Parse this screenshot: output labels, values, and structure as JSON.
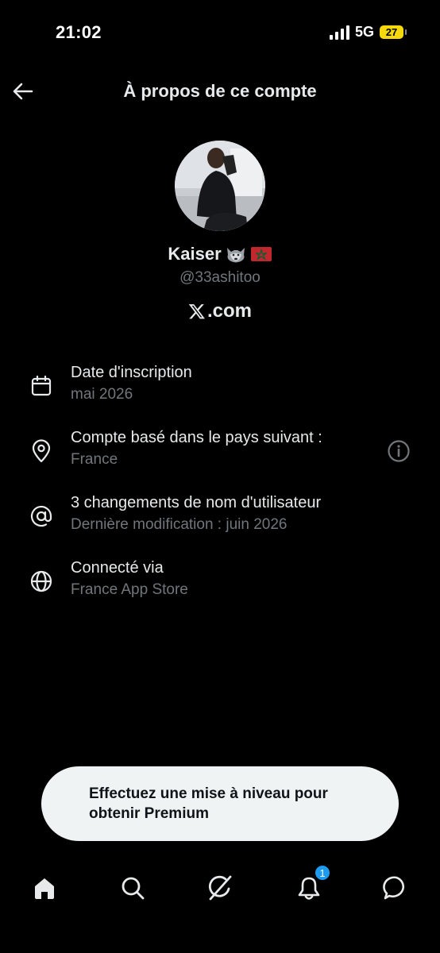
{
  "status_bar": {
    "time": "21:02",
    "network": "5G",
    "battery": "27"
  },
  "header": {
    "title": "À propos de ce compte"
  },
  "profile": {
    "display_name": "Kaiser",
    "username": "@33ashitoo",
    "brand": "X.com",
    "brand_suffix": ".com"
  },
  "info_items": [
    {
      "icon": "calendar-icon",
      "title": "Date d'inscription",
      "subtitle": "mai 2026"
    },
    {
      "icon": "location-pin-icon",
      "title": "Compte basé dans le pays suivant :",
      "subtitle": "France"
    },
    {
      "icon": "at-sign-icon",
      "title": "3 changements de nom d'utilisateur",
      "subtitle": "Dernière modification : juin 2026"
    },
    {
      "icon": "globe-icon",
      "title": "Connecté via",
      "subtitle": "France App Store"
    }
  ],
  "premium_banner": {
    "text": "Effectuez une mise à niveau pour obtenir Premium"
  },
  "bottom_nav": {
    "items": [
      "home-icon",
      "search-icon",
      "grok-icon",
      "notifications-icon",
      "messages-icon"
    ],
    "notification_count": "1"
  },
  "colors": {
    "background": "#000000",
    "text_primary": "#e7e9ea",
    "text_secondary": "#71767b",
    "accent": "#1d9bf0",
    "battery": "#f5d90a"
  }
}
